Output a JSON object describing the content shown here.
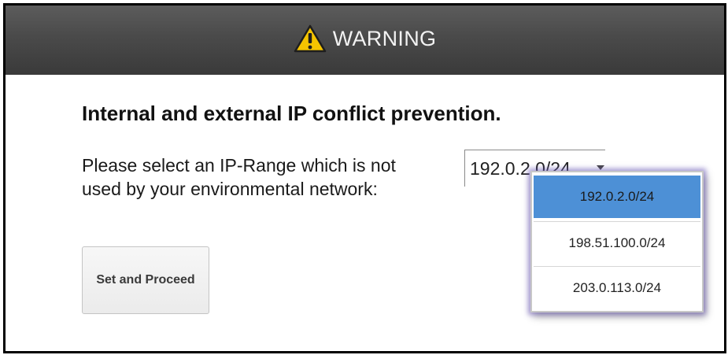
{
  "dialog": {
    "title": "WARNING",
    "title_icon": "warning-triangle-icon",
    "heading": "Internal and external IP conflict prevention.",
    "prompt": "Please select an IP-Range which is not used by your environmental network:",
    "proceed_label": "Set and Proceed"
  },
  "ip_select": {
    "value": "192.0.2.0/24",
    "options": [
      "192.0.2.0/24",
      "198.51.100.0/24",
      "203.0.113.0/24"
    ],
    "selected_index": 0
  },
  "colors": {
    "titlebar": "#4a4a4a",
    "warning_icon": "#f5c400",
    "selected_option": "#4d90d6",
    "dropdown_glow": "#6e5abe"
  }
}
